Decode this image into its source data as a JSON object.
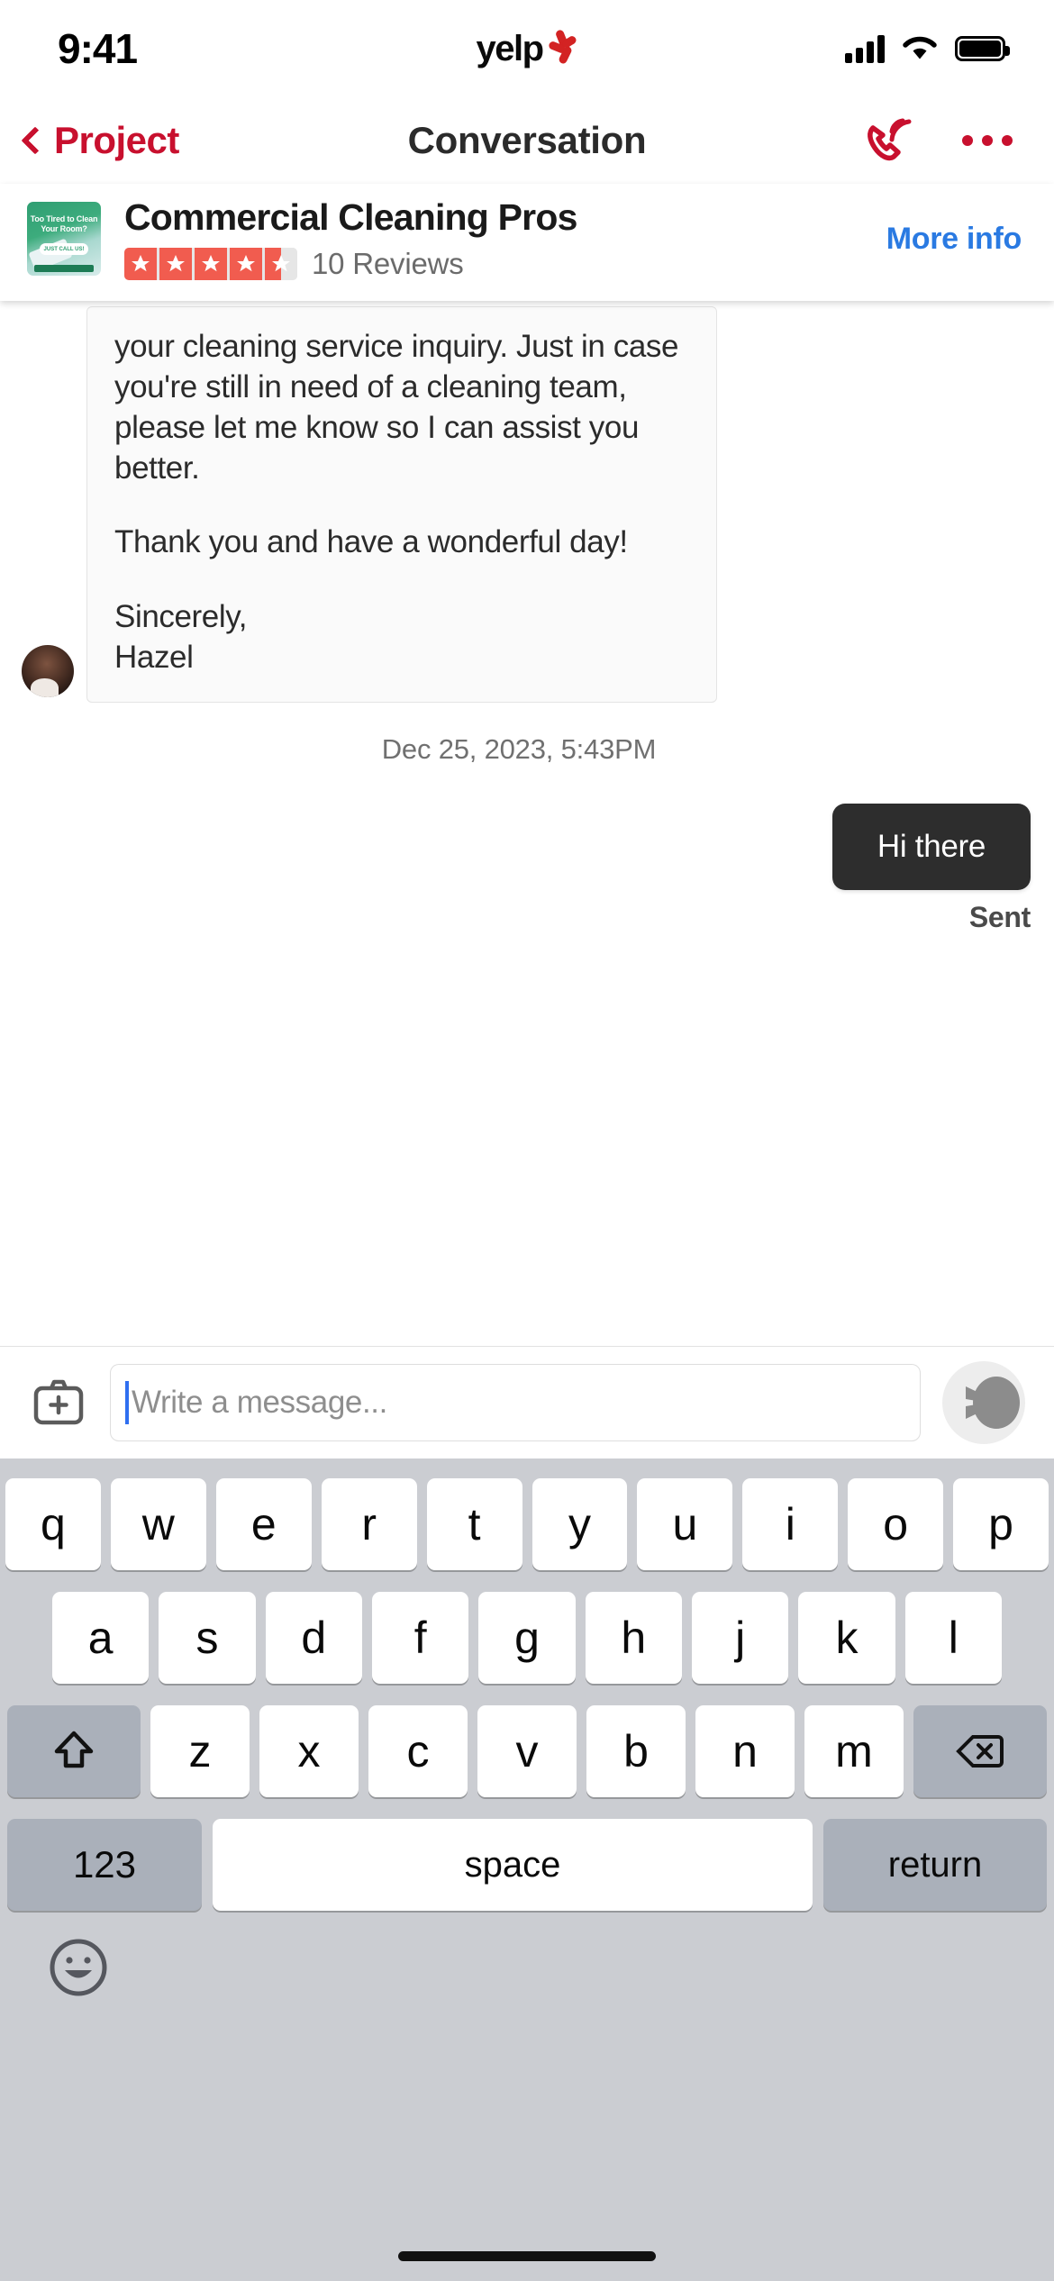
{
  "status_bar": {
    "time": "9:41",
    "brand": "yelp",
    "icons": [
      "cellular-signal-icon",
      "wifi-icon",
      "battery-icon"
    ]
  },
  "nav_bar": {
    "back_label": "Project",
    "title": "Conversation",
    "call_icon": "phone-call-icon",
    "more_icon": "more-options-icon"
  },
  "business_card": {
    "thumbnail_alt": "Too Tired to Clean Your Room? JUST CALL US!",
    "thumb_line1": "Too Tired to Clean",
    "thumb_line2": "Your Room?",
    "thumb_pill": "JUST CALL US!",
    "name": "Commercial Cleaning Pros",
    "rating": 4.5,
    "stars_total": 5,
    "reviews_label": "10 Reviews",
    "more_info_label": "More info",
    "star_color": "#f15c4f",
    "link_color": "#2a7ae2"
  },
  "thread": {
    "incoming_message": {
      "sender": "Hazel",
      "paragraphs": [
        "your cleaning service inquiry. Just in case you're still in need of a cleaning team, please let me know so I can assist you better.",
        "Thank you and have a wonderful day!",
        "Sincerely,\nHazel"
      ]
    },
    "timestamp": "Dec 25, 2023, 5:43PM",
    "outgoing_message": {
      "text": "Hi there",
      "status": "Sent"
    }
  },
  "composer": {
    "camera_icon": "camera-add-icon",
    "placeholder": "Write a message...",
    "value": "",
    "send_icon": "send-icon"
  },
  "keyboard": {
    "row1": [
      "q",
      "w",
      "e",
      "r",
      "t",
      "y",
      "u",
      "i",
      "o",
      "p"
    ],
    "row2": [
      "a",
      "s",
      "d",
      "f",
      "g",
      "h",
      "j",
      "k",
      "l"
    ],
    "row3": [
      "z",
      "x",
      "c",
      "v",
      "b",
      "n",
      "m"
    ],
    "shift_icon": "shift-arrow-icon",
    "backspace_icon": "backspace-icon",
    "numbers_label": "123",
    "space_label": "space",
    "return_label": "return",
    "emoji_icon": "emoji-smiley-icon"
  }
}
